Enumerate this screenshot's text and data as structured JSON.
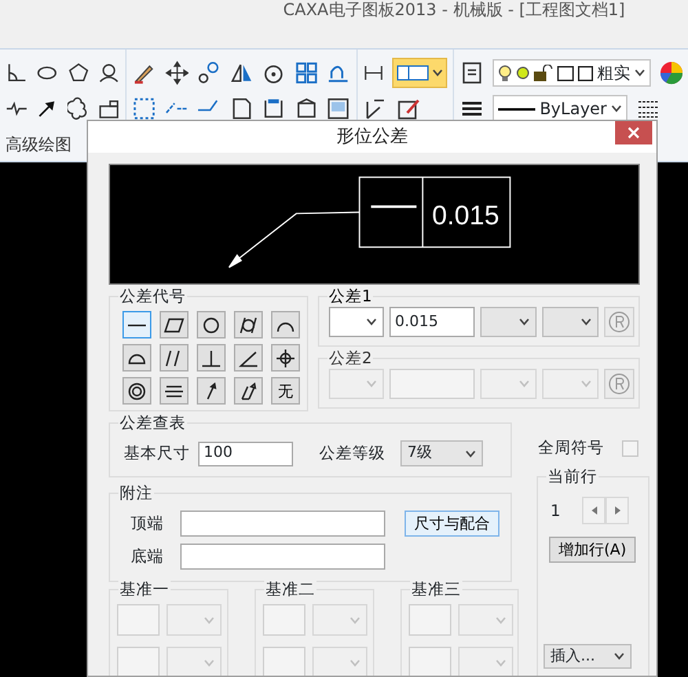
{
  "app_title": "CAXA电子图板2013 - 机械版 - [工程图文档1]",
  "ribbon": {
    "panel_label": "高级绘图",
    "layer_style": "粗实",
    "linetype": "ByLayer"
  },
  "dialog": {
    "title": "形位公差",
    "preview": {
      "value": "0.015"
    },
    "symbols": {
      "label": "公差代号",
      "items": [
        {
          "kind": "straightness",
          "selected": true
        },
        {
          "kind": "flatness",
          "selected": false
        },
        {
          "kind": "circularity",
          "selected": false
        },
        {
          "kind": "cylindricity",
          "selected": false
        },
        {
          "kind": "line_profile",
          "selected": false
        },
        {
          "kind": "surface_profile",
          "selected": false
        },
        {
          "kind": "parallelism",
          "selected": false
        },
        {
          "kind": "perpendicularity",
          "selected": false
        },
        {
          "kind": "angularity",
          "selected": false
        },
        {
          "kind": "position",
          "selected": false
        },
        {
          "kind": "concentricity",
          "selected": false
        },
        {
          "kind": "symmetry",
          "selected": false
        },
        {
          "kind": "circular_runout",
          "selected": false
        },
        {
          "kind": "total_runout",
          "selected": false
        },
        {
          "kind": "none",
          "label": "无",
          "selected": false
        }
      ]
    },
    "tolerances": [
      {
        "label": "公差1",
        "value": "0.015",
        "enabled": true
      },
      {
        "label": "公差2",
        "enabled": false
      }
    ],
    "lookup": {
      "label": "公差查表",
      "size_label": "基本尺寸",
      "size": "100",
      "grade_label": "公差等级",
      "grade": "7级"
    },
    "all_around": {
      "label": "全周符号",
      "checked": false
    },
    "current_row": {
      "label": "当前行",
      "value": "1",
      "add_button": "增加行(A)",
      "insert_button": "插入..."
    },
    "note": {
      "label": "附注",
      "top_label": "顶端",
      "bottom_label": "底端",
      "fit_button": "尺寸与配合"
    },
    "datums": [
      {
        "label": "基准一"
      },
      {
        "label": "基准二"
      },
      {
        "label": "基准三"
      }
    ]
  }
}
